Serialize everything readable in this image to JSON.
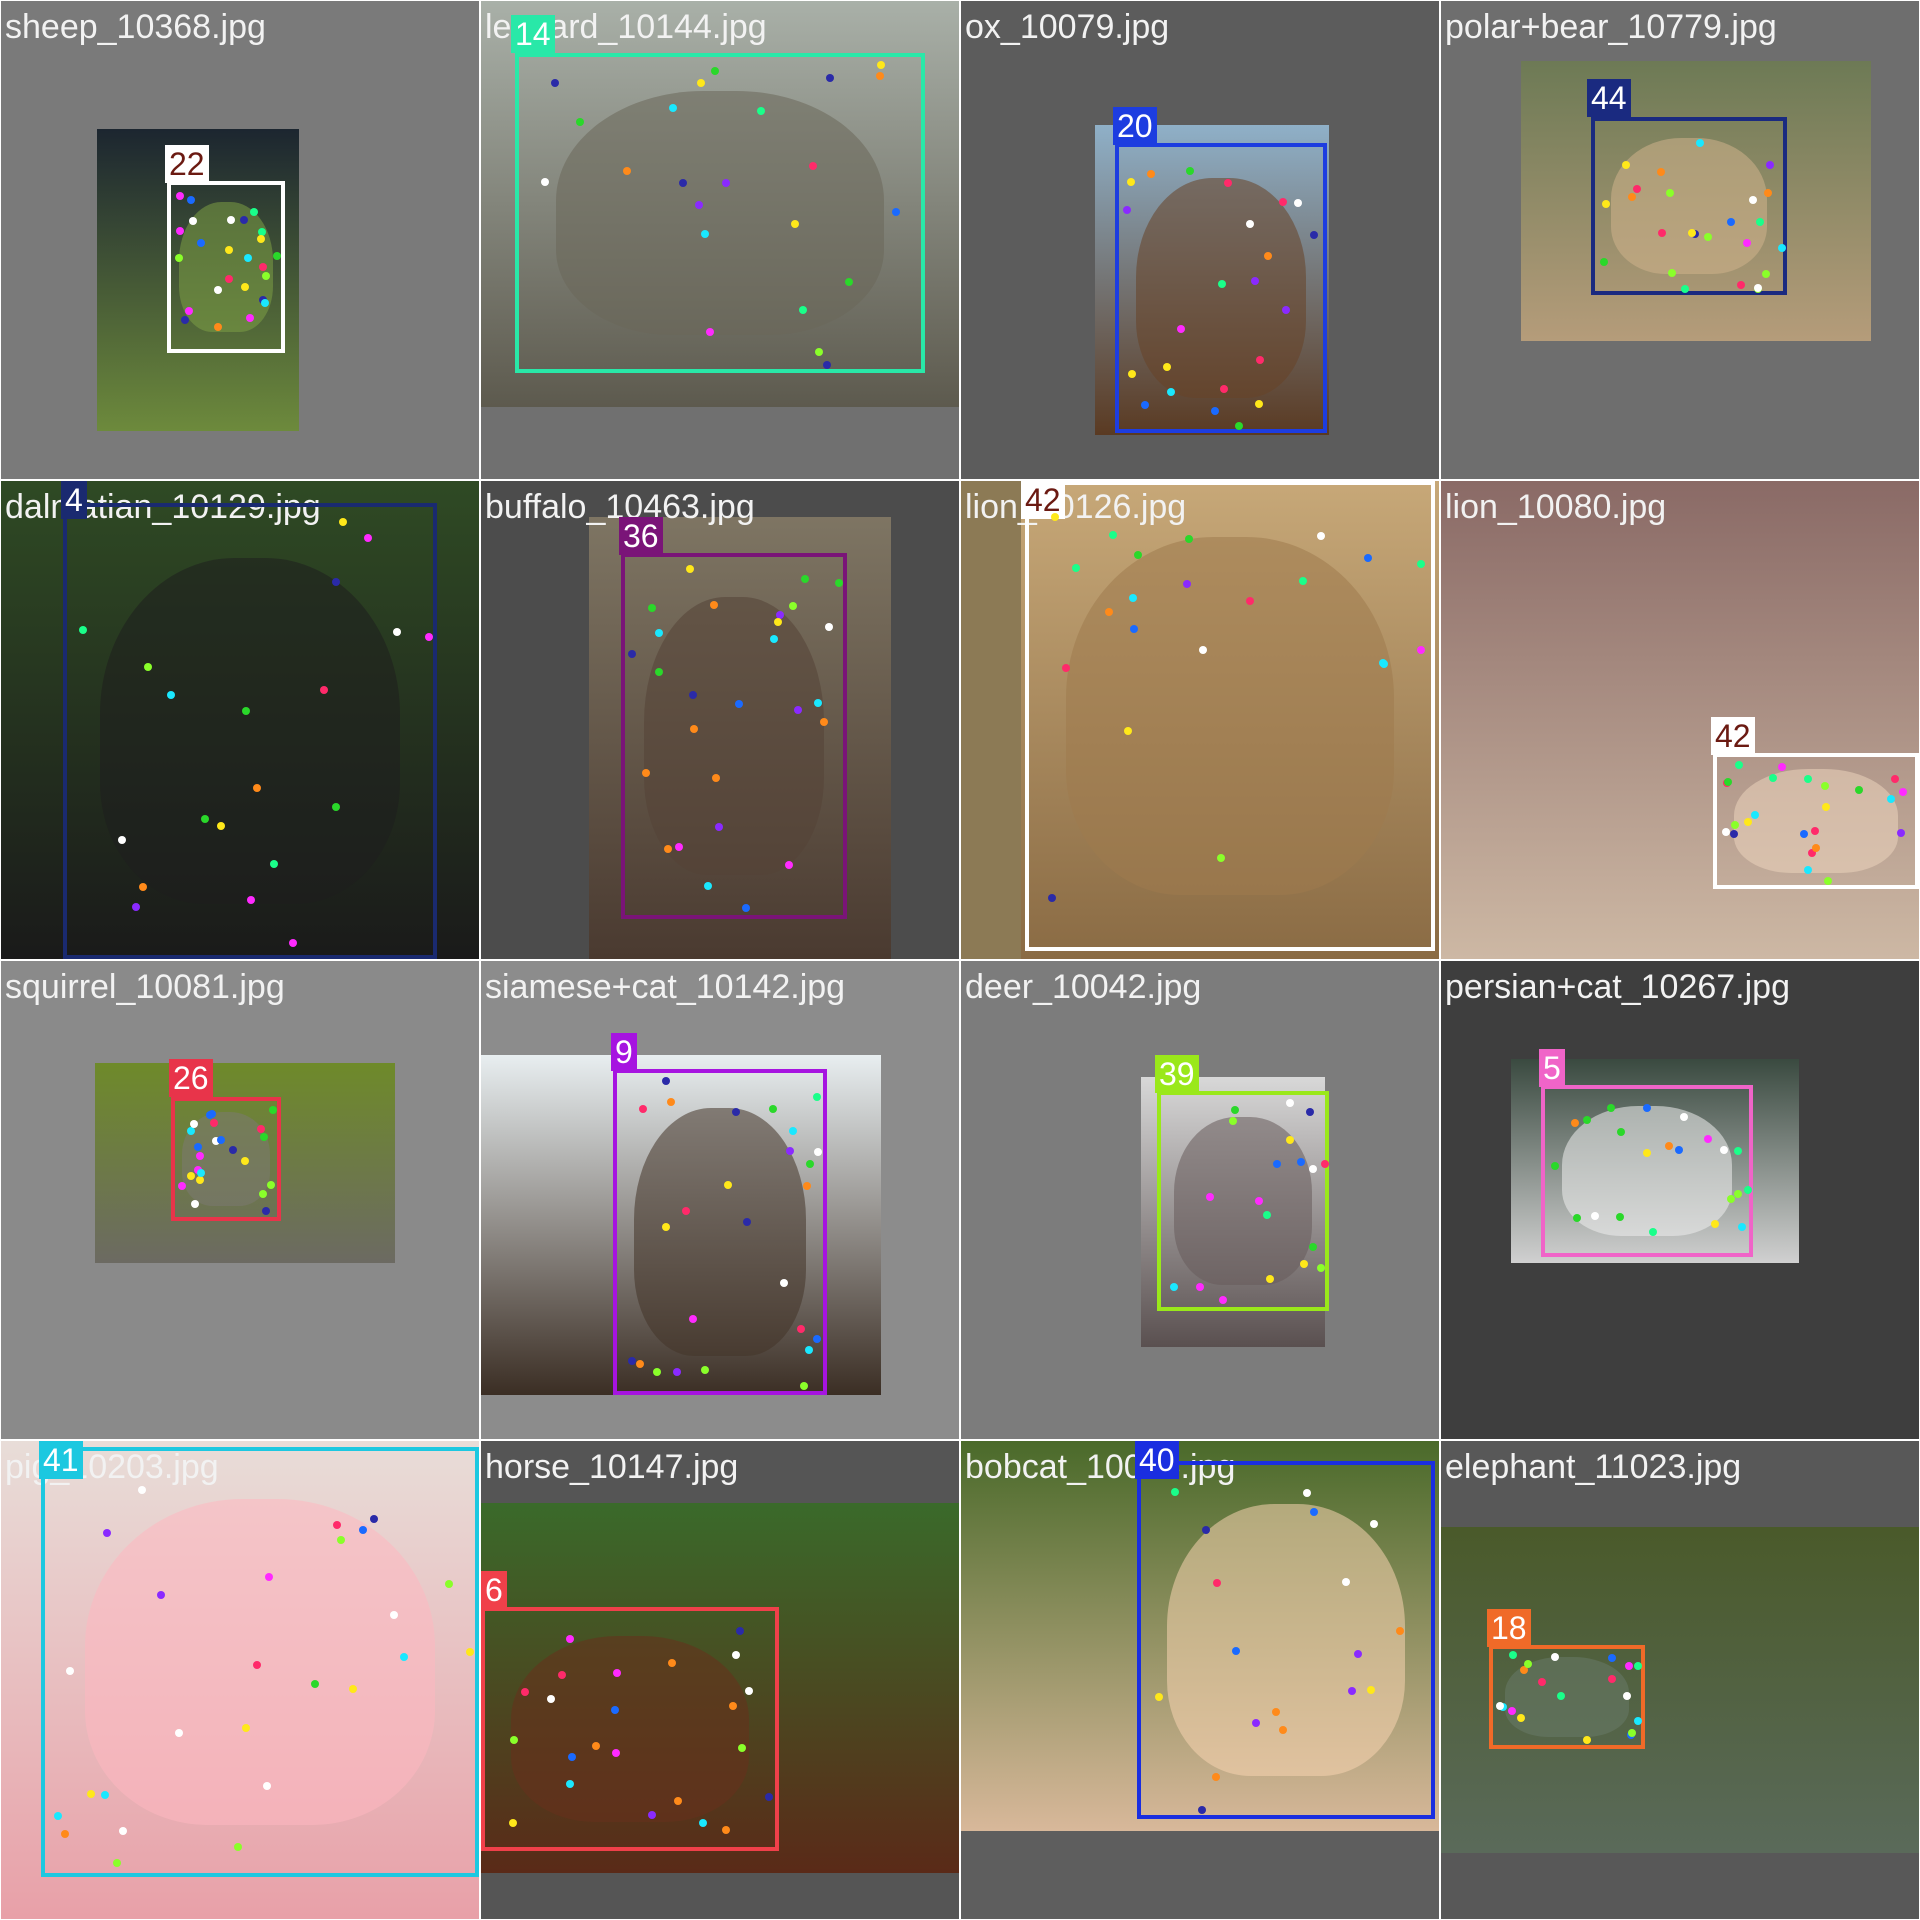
{
  "tiles": [
    {
      "filename": "sheep_10368.jpg",
      "label": "22",
      "bg": "#7a7a7a",
      "photo_colors": [
        "#1c2630",
        "#6d8a3c"
      ],
      "box_color": "#ffffff",
      "badge_text_color": "#6b1a12",
      "subject": "sheep"
    },
    {
      "filename": "leopard_10144.jpg",
      "label": "14",
      "bg": "#707070",
      "photo_colors": [
        "#a9b0a8",
        "#5d5a4e"
      ],
      "box_color": "#29e8a8",
      "badge_text_color": "#ffffff",
      "subject": "leopard"
    },
    {
      "filename": "ox_10079.jpg",
      "label": "20",
      "bg": "#5c5c5c",
      "photo_colors": [
        "#8fb0c8",
        "#5a3a22"
      ],
      "box_color": "#1d3de0",
      "badge_text_color": "#ffffff",
      "subject": "ox"
    },
    {
      "filename": "polar+bear_10779.jpg",
      "label": "44",
      "bg": "#6e6e6e",
      "photo_colors": [
        "#6d7a55",
        "#b59c7a"
      ],
      "box_color": "#1a2a80",
      "badge_text_color": "#ffffff",
      "subject": "polar bear"
    },
    {
      "filename": "dalmatian_10129.jpg",
      "label": "4",
      "bg": "#3a4a2a",
      "photo_colors": [
        "#2f4a24",
        "#1a1a1a"
      ],
      "box_color": "#1a2a70",
      "badge_text_color": "#ffffff",
      "subject": "dalmatian"
    },
    {
      "filename": "buffalo_10463.jpg",
      "label": "36",
      "bg": "#4c4c4c",
      "photo_colors": [
        "#7e7563",
        "#4a3a30"
      ],
      "box_color": "#7a1478",
      "badge_text_color": "#ffffff",
      "subject": "buffalo"
    },
    {
      "filename": "lion_10126.jpg",
      "label": "42",
      "bg": "#8c7a55",
      "photo_colors": [
        "#c7a878",
        "#8a6b44"
      ],
      "box_color": "#ffffff",
      "badge_text_color": "#6b1a12",
      "subject": "lion"
    },
    {
      "filename": "lion_10080.jpg",
      "label": "42",
      "bg": "#8a6a66",
      "photo_colors": [
        "#8a6a66",
        "#cdb8a4"
      ],
      "box_color": "#ffffff",
      "badge_text_color": "#6b1a12",
      "subject": "lion"
    },
    {
      "filename": "squirrel_10081.jpg",
      "label": "26",
      "bg": "#8a8a8a",
      "photo_colors": [
        "#6e8a2a",
        "#6c6a62"
      ],
      "box_color": "#e8344a",
      "badge_text_color": "#ffffff",
      "subject": "squirrel"
    },
    {
      "filename": "siamese+cat_10142.jpg",
      "label": "9",
      "bg": "#8c8c8c",
      "photo_colors": [
        "#e8eef0",
        "#3b2e24"
      ],
      "box_color": "#a614e0",
      "badge_text_color": "#ffffff",
      "subject": "siamese cat"
    },
    {
      "filename": "deer_10042.jpg",
      "label": "39",
      "bg": "#7c7c7c",
      "photo_colors": [
        "#d8d8d8",
        "#5a5050"
      ],
      "box_color": "#9ae81a",
      "badge_text_color": "#ffffff",
      "subject": "deer"
    },
    {
      "filename": "persian+cat_10267.jpg",
      "label": "5",
      "bg": "#3e3e3e",
      "photo_colors": [
        "#3a4a40",
        "#d0d0d0"
      ],
      "box_color": "#f064c8",
      "badge_text_color": "#ffffff",
      "subject": "persian cat"
    },
    {
      "filename": "pig_10203.jpg",
      "label": "41",
      "bg": "#c8b8b0",
      "photo_colors": [
        "#e8ddd8",
        "#e8a0a8"
      ],
      "box_color": "#1cc8e0",
      "badge_text_color": "#ffffff",
      "subject": "pig"
    },
    {
      "filename": "horse_10147.jpg",
      "label": "6",
      "bg": "#555555",
      "photo_colors": [
        "#3a6a2a",
        "#5a2a18"
      ],
      "box_color": "#f0404a",
      "badge_text_color": "#ffffff",
      "subject": "horse"
    },
    {
      "filename": "bobcat_10005.jpg",
      "label": "40",
      "bg": "#5e5e5e",
      "photo_colors": [
        "#4a6a2a",
        "#d8b89a"
      ],
      "box_color": "#1a2ee0",
      "badge_text_color": "#ffffff",
      "subject": "bobcat"
    },
    {
      "filename": "elephant_11023.jpg",
      "label": "18",
      "bg": "#585858",
      "photo_colors": [
        "#4a5a2a",
        "#5a6a5a"
      ],
      "box_color": "#f06a28",
      "badge_text_color": "#ffffff",
      "subject": "elephant"
    }
  ],
  "keypoint_colors": [
    "#ff2a6a",
    "#ff8a1a",
    "#ffe81a",
    "#8aff2a",
    "#1aff8a",
    "#1ae8ff",
    "#1a6aff",
    "#8a2aff",
    "#ff2aff",
    "#ffffff",
    "#2a2aa8",
    "#2ad82a"
  ]
}
